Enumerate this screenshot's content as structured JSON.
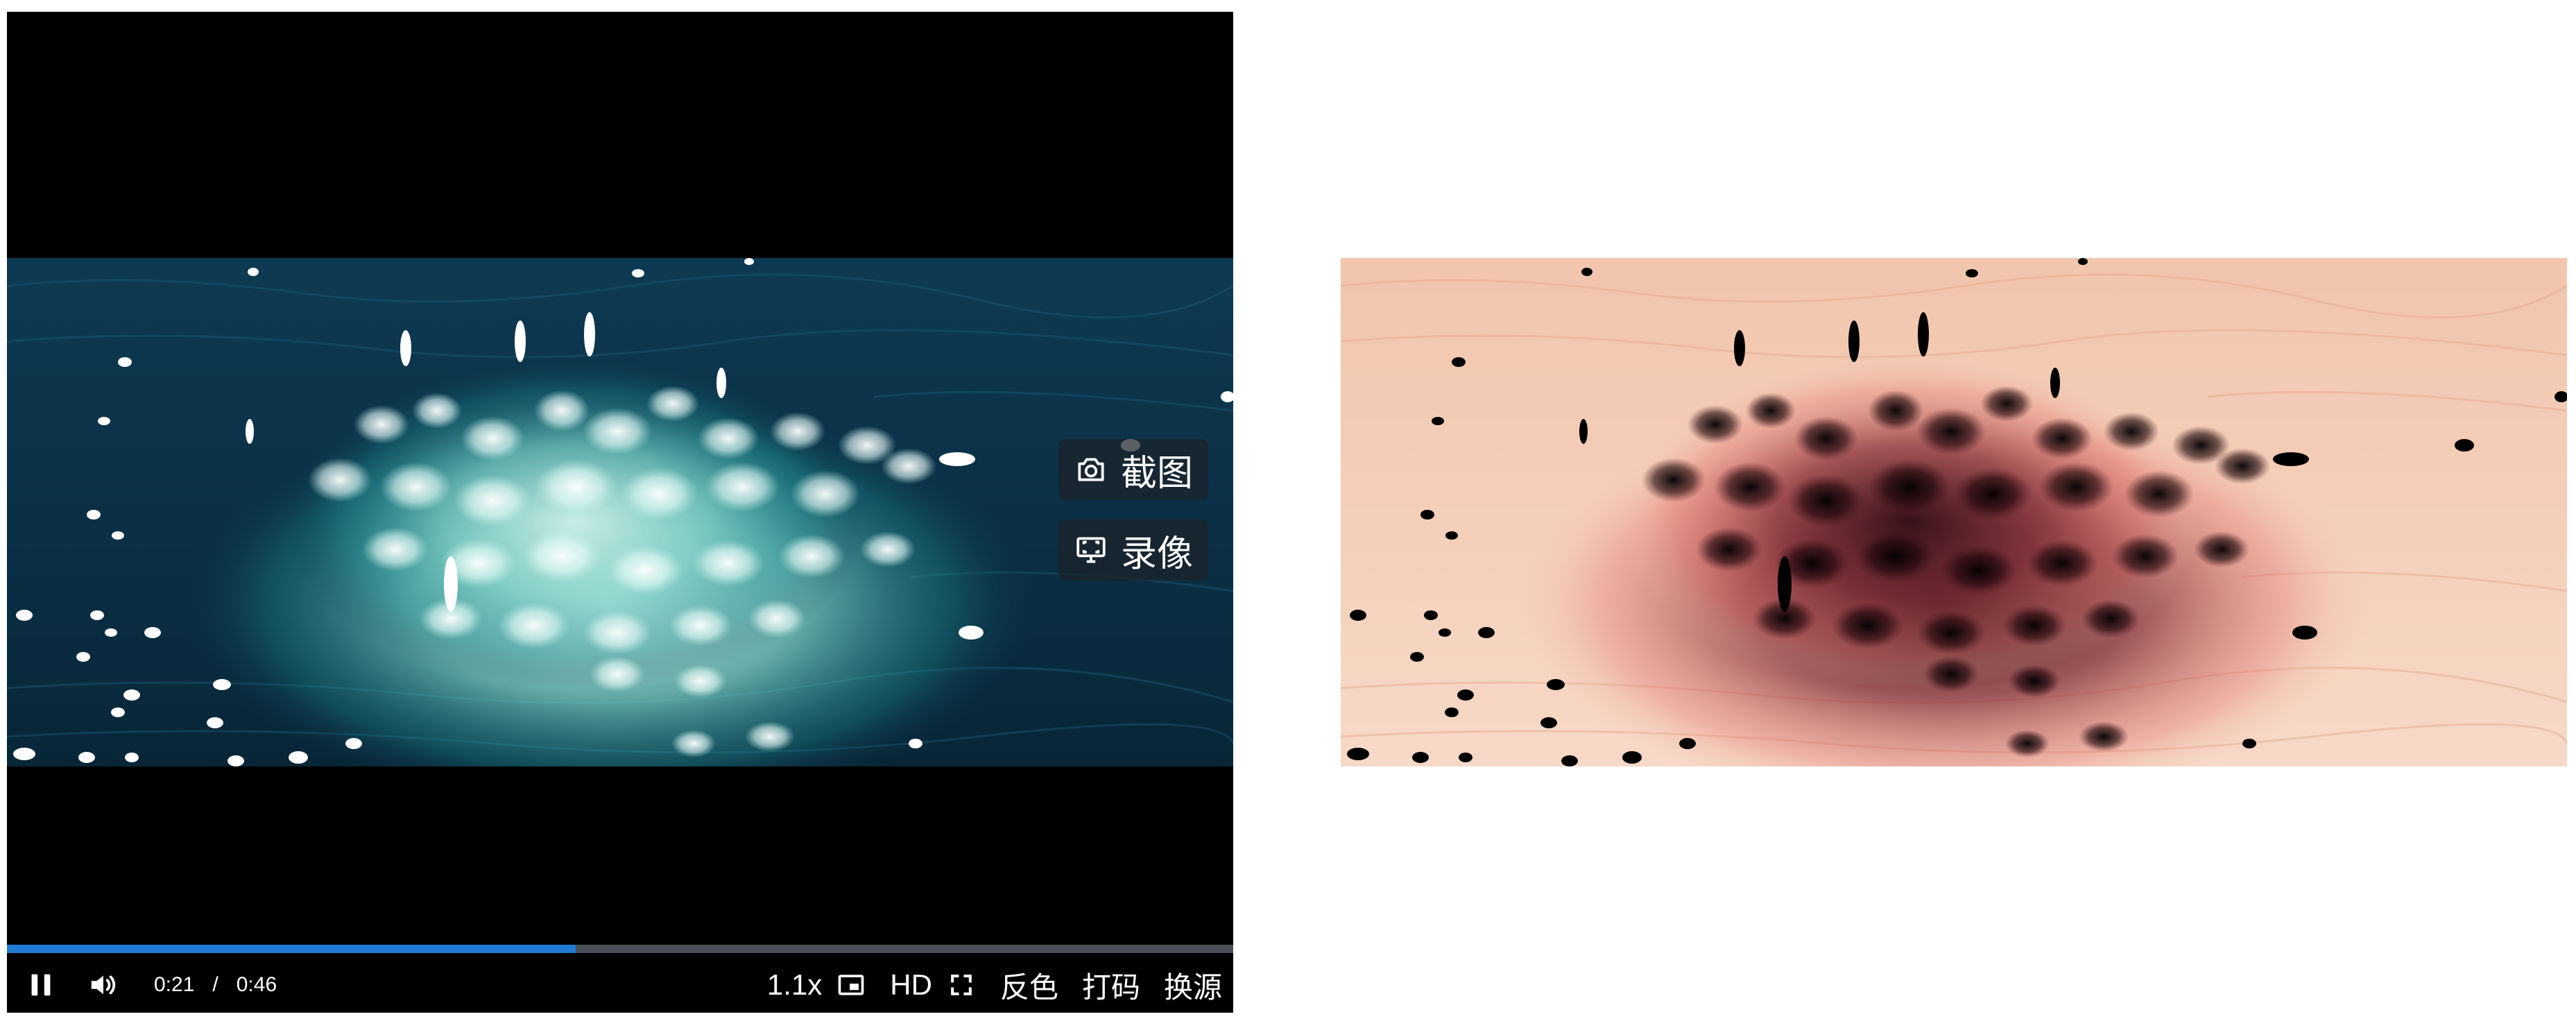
{
  "player": {
    "actions": {
      "screenshot_label": "截图",
      "record_label": "录像"
    },
    "progress_fraction": 0.464,
    "time": {
      "current": "0:21",
      "separator": "/",
      "duration": "0:46"
    },
    "controls": {
      "speed_label": "1.1x",
      "quality_label": "HD",
      "invert_label": "反色",
      "watermark_label": "打码",
      "switch_source_label": "换源"
    },
    "icons": {
      "pause": "pause-icon",
      "volume": "volume-icon",
      "camera": "camera-icon",
      "record": "monitor-record-icon",
      "pip": "picture-in-picture-icon",
      "fullscreen": "fullscreen-icon"
    },
    "colors": {
      "progress_fill": "#1f7bd6",
      "progress_track": "#4a4f57",
      "ocean_dark": "#0b2f43",
      "ocean_light": "#1f5d75",
      "splash": "#bfeee6"
    }
  }
}
